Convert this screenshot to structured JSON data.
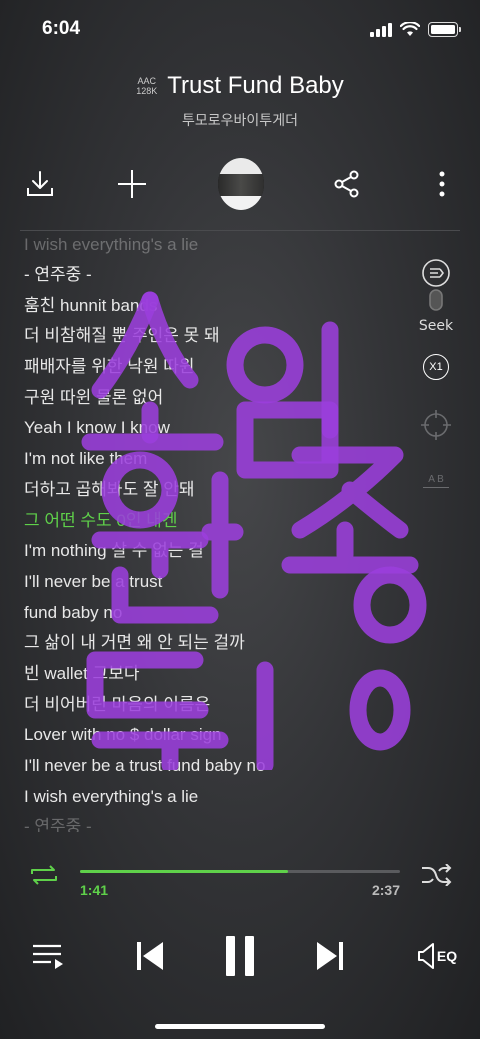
{
  "status_bar": {
    "time": "6:04"
  },
  "header": {
    "codec_line1": "AAC",
    "codec_line2": "128K",
    "title": "Trust Fund Baby",
    "artist": "투모로우바이투게더"
  },
  "toolbar": {
    "icons": [
      "download-icon",
      "add-icon",
      "album-art",
      "share-icon",
      "more-icon"
    ]
  },
  "lyrics": {
    "lines": [
      "I wish everything's a lie",
      " - 연주중 -",
      "훔친 hunnit bands",
      "더 비참해질 뿐 주인은 못 돼",
      "패배자를 위한 낙원 따윈",
      "구원 따윈 물론 없어",
      "Yeah I know I know",
      "I'm not like them",
      "더하고 곱해봐도 잘 안돼",
      "그 어떤 수도 0인 내겐",
      "I'm nothing 살 수 없는 걸",
      "I'll never be a trust",
      "fund baby no",
      "그 삶이 내 거면 왜 안 되는 걸까",
      "빈 wallet 그보다",
      "더 비어버린 마음의 이름은",
      "Lover with no $ dollar sign",
      "I'll never be a trust fund baby no",
      "I wish everything's a lie",
      " - 연주중 -"
    ],
    "active_index": 9
  },
  "side_controls": {
    "seek_label": "Seek",
    "speed_label": "X1",
    "ab_label": "A B"
  },
  "overlay_text": "소원 임종 뒤",
  "playback": {
    "current_time": "1:41",
    "total_time": "2:37",
    "progress_fraction": 0.65
  },
  "controls": {
    "eq_label": "EQ"
  },
  "colors": {
    "accent": "#5fd14a",
    "scribble": "#9b3fdc"
  }
}
